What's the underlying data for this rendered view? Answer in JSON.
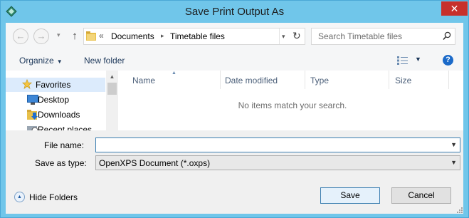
{
  "window": {
    "title": "Save Print Output As",
    "close_glyph": "✕"
  },
  "nav": {
    "back_glyph": "←",
    "forward_glyph": "→",
    "up_glyph": "↑",
    "breadcrumb_prefix": "«",
    "breadcrumb": [
      "Documents",
      "Timetable files"
    ],
    "refresh_glyph": "↻"
  },
  "search": {
    "placeholder": "Search Timetable files",
    "icon": "search-icon"
  },
  "commandbar": {
    "organize_label": "Organize",
    "new_folder_label": "New folder",
    "help_glyph": "?"
  },
  "navpane": {
    "items": [
      {
        "label": "Favorites",
        "icon": "star-icon"
      },
      {
        "label": "Desktop",
        "icon": "desktop-icon"
      },
      {
        "label": "Downloads",
        "icon": "downloads-icon"
      },
      {
        "label": "Recent places",
        "icon": "recent-places-icon"
      }
    ]
  },
  "filelist": {
    "columns": [
      "Name",
      "Date modified",
      "Type",
      "Size"
    ],
    "empty_message": "No items match your search."
  },
  "form": {
    "file_name_label": "File name:",
    "file_name_value": "",
    "save_as_type_label": "Save as type:",
    "save_as_type_value": "OpenXPS Document (*.oxps)"
  },
  "footer": {
    "hide_folders_label": "Hide Folders",
    "save_label": "Save",
    "cancel_label": "Cancel"
  },
  "colors": {
    "title_bar": "#70c6ea",
    "close_button": "#c7312b",
    "link_text": "#1e395b",
    "selection": "#dcebfc"
  }
}
